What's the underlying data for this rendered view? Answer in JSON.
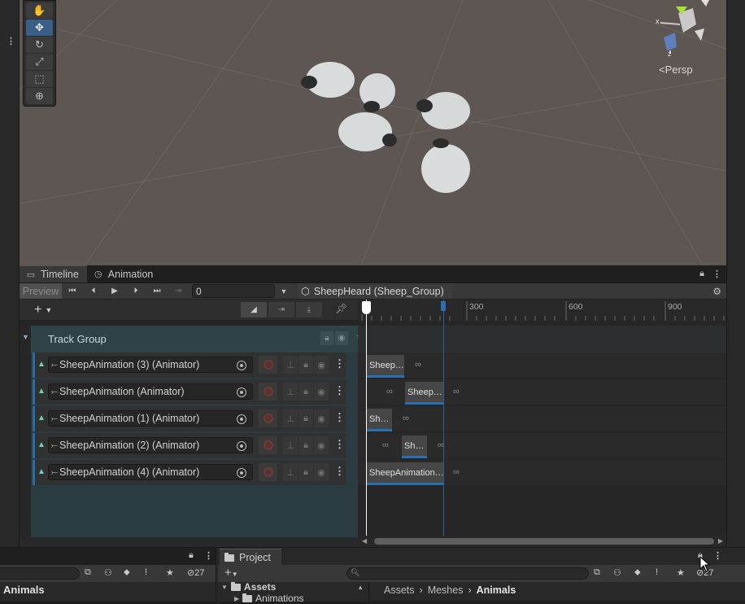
{
  "scene": {
    "camera_mode": "Persp",
    "gizmo_axes": [
      "x",
      "z"
    ],
    "tools": [
      "hand-icon",
      "move-icon",
      "rotate-icon",
      "scale-icon",
      "rect-icon",
      "transform-icon"
    ],
    "active_tool": "move-icon"
  },
  "timeline": {
    "tabs": [
      {
        "label": "Timeline",
        "icon": "timeline-icon",
        "active": true
      },
      {
        "label": "Animation",
        "icon": "clock-icon",
        "active": false
      }
    ],
    "preview_label": "Preview",
    "frame_value": "0",
    "breadcrumb": "SheepHeard (Sheep_Group)",
    "ruler_ticks": [
      "300",
      "600",
      "900"
    ],
    "track_group": {
      "title": "Track Group"
    },
    "tracks": [
      {
        "name": "SheepAnimation (3) (Animator)",
        "clips": [
          {
            "label": "Sheep…"
          }
        ]
      },
      {
        "name": "SheepAnimation (Animator)",
        "clips": [
          {
            "label": "Sheep…"
          }
        ]
      },
      {
        "name": "SheepAnimation (1) (Animator)",
        "clips": [
          {
            "label": "Sh…"
          }
        ]
      },
      {
        "name": "SheepAnimation (2) (Animator)",
        "clips": [
          {
            "label": "Sh…"
          }
        ]
      },
      {
        "name": "SheepAnimation (4) (Animator)",
        "clips": [
          {
            "label": "SheepAnimation…"
          }
        ]
      }
    ]
  },
  "hierarchy_pane": {
    "selected_folder": "Animals",
    "hidden_count": "27"
  },
  "project": {
    "tab_label": "Project",
    "hidden_count": "27",
    "tree": {
      "root": "Assets",
      "child": "Animations"
    },
    "path": [
      "Assets",
      "Meshes",
      "Animals"
    ]
  },
  "colors": {
    "accent_blue": "#2c6fb0",
    "track_group_bg": "#2b3c40",
    "scene_bg": "#5d5652",
    "animator_icon": "#6ed0c0"
  }
}
